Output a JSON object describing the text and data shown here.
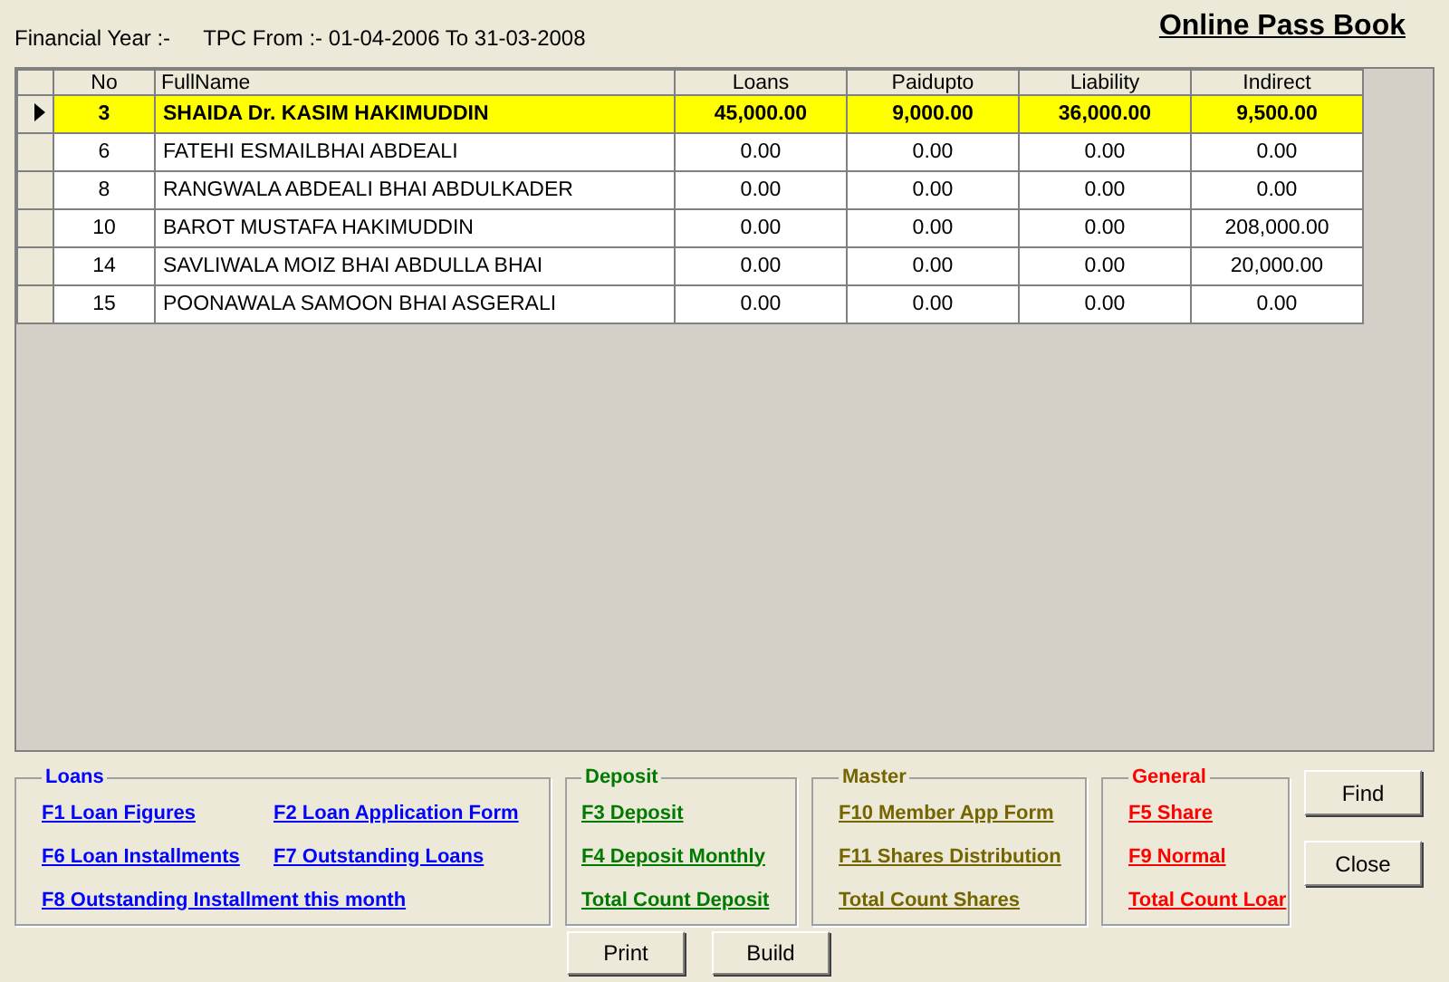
{
  "header": {
    "financial_year": "Financial Year :-",
    "period": "TPC From :- 01-04-2006 To 31-03-2008",
    "title": "Online Pass Book"
  },
  "table": {
    "columns": [
      "No",
      "FullName",
      "Loans",
      "Paidupto",
      "Liability",
      "Indirect"
    ],
    "rows": [
      {
        "selected": true,
        "cells": [
          "3",
          "SHAIDA Dr. KASIM HAKIMUDDIN",
          "45,000.00",
          "9,000.00",
          "36,000.00",
          "9,500.00"
        ]
      },
      {
        "selected": false,
        "cells": [
          "6",
          "FATEHI ESMAILBHAI ABDEALI",
          "0.00",
          "0.00",
          "0.00",
          "0.00"
        ]
      },
      {
        "selected": false,
        "cells": [
          "8",
          "RANGWALA ABDEALI BHAI ABDULKADER",
          "0.00",
          "0.00",
          "0.00",
          "0.00"
        ]
      },
      {
        "selected": false,
        "cells": [
          "10",
          "BAROT MUSTAFA HAKIMUDDIN",
          "0.00",
          "0.00",
          "0.00",
          "208,000.00"
        ]
      },
      {
        "selected": false,
        "cells": [
          "14",
          "SAVLIWALA MOIZ BHAI ABDULLA BHAI",
          "0.00",
          "0.00",
          "0.00",
          "20,000.00"
        ]
      },
      {
        "selected": false,
        "cells": [
          "15",
          "POONAWALA SAMOON BHAI ASGERALI",
          "0.00",
          "0.00",
          "0.00",
          "0.00"
        ]
      }
    ]
  },
  "groups": [
    {
      "title": "Loans",
      "color": "#0000ff",
      "rows": [
        [
          "F1 Loan Figures",
          "F2 Loan Application Form"
        ],
        [
          "F6 Loan Installments",
          "F7 Outstanding Loans"
        ],
        [
          "F8 Outstanding Installment this month"
        ]
      ]
    },
    {
      "title": "Deposit",
      "color": "#007a00",
      "rows": [
        [
          "F3 Deposit"
        ],
        [
          "F4 Deposit Monthly"
        ],
        [
          "Total Count Deposit"
        ]
      ]
    },
    {
      "title": "Master",
      "color": "#756500",
      "rows": [
        [
          "F10 Member App Form"
        ],
        [
          "F11 Shares Distribution"
        ],
        [
          "Total Count Shares"
        ]
      ]
    },
    {
      "title": "General",
      "color": "#ff0000",
      "rows": [
        [
          "F5 Share"
        ],
        [
          "F9 Normal"
        ],
        [
          "Total Count Loar"
        ]
      ]
    }
  ],
  "side_buttons": [
    "Find",
    "Close"
  ],
  "bottom_buttons": [
    "Print",
    "Build"
  ]
}
